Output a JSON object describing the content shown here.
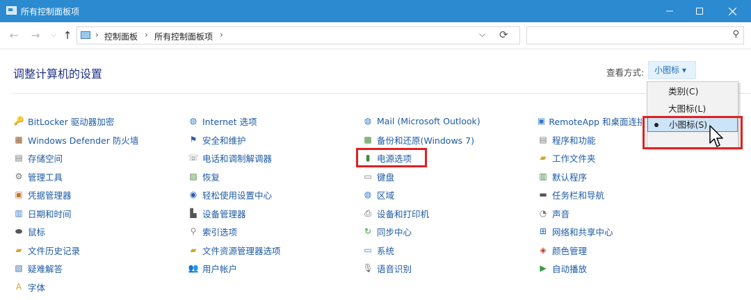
{
  "window": {
    "title": "所有控制面板项"
  },
  "address": {
    "crumbs": [
      "控制面板",
      "所有控制面板项"
    ],
    "dropdown": "⌵",
    "refresh": "⟳",
    "search_placeholder": ""
  },
  "heading": "调整计算机的设置",
  "view": {
    "label": "查看方式:",
    "value": "小图标 ▾",
    "menu": [
      "类别(C)",
      "大图标(L)",
      "小图标(S)"
    ],
    "selected": "小图标(S)"
  },
  "columns": [
    [
      {
        "label": "BitLocker 驱动器加密",
        "icon": "key-icon"
      },
      {
        "label": "Windows Defender 防火墙",
        "icon": "firewall-icon"
      },
      {
        "label": "存储空间",
        "icon": "storage-icon"
      },
      {
        "label": "管理工具",
        "icon": "tools-icon"
      },
      {
        "label": "凭据管理器",
        "icon": "credential-icon"
      },
      {
        "label": "日期和时间",
        "icon": "calendar-icon"
      },
      {
        "label": "鼠标",
        "icon": "mouse-icon"
      },
      {
        "label": "文件历史记录",
        "icon": "file-history-icon"
      },
      {
        "label": "疑难解答",
        "icon": "troubleshoot-icon"
      },
      {
        "label": "字体",
        "icon": "font-icon"
      }
    ],
    [
      {
        "label": "Internet 选项",
        "icon": "globe-icon"
      },
      {
        "label": "安全和维护",
        "icon": "flag-icon"
      },
      {
        "label": "电话和调制解调器",
        "icon": "phone-icon"
      },
      {
        "label": "恢复",
        "icon": "recovery-icon"
      },
      {
        "label": "轻松使用设置中心",
        "icon": "accessibility-icon"
      },
      {
        "label": "设备管理器",
        "icon": "device-manager-icon"
      },
      {
        "label": "索引选项",
        "icon": "index-icon"
      },
      {
        "label": "文件资源管理器选项",
        "icon": "folder-options-icon"
      },
      {
        "label": "用户帐户",
        "icon": "users-icon"
      }
    ],
    [
      {
        "label": "Mail (Microsoft Outlook)",
        "icon": "mail-icon"
      },
      {
        "label": "备份和还原(Windows 7)",
        "icon": "backup-icon"
      },
      {
        "label": "电源选项",
        "icon": "power-icon"
      },
      {
        "label": "键盘",
        "icon": "keyboard-icon"
      },
      {
        "label": "区域",
        "icon": "region-icon"
      },
      {
        "label": "设备和打印机",
        "icon": "printer-icon"
      },
      {
        "label": "同步中心",
        "icon": "sync-icon"
      },
      {
        "label": "系统",
        "icon": "system-icon"
      },
      {
        "label": "语音识别",
        "icon": "microphone-icon"
      }
    ],
    [
      {
        "label": "RemoteApp 和桌面连接",
        "icon": "remoteapp-icon"
      },
      {
        "label": "程序和功能",
        "icon": "programs-icon"
      },
      {
        "label": "工作文件夹",
        "icon": "work-folders-icon"
      },
      {
        "label": "默认程序",
        "icon": "default-programs-icon"
      },
      {
        "label": "任务栏和导航",
        "icon": "taskbar-icon"
      },
      {
        "label": "声音",
        "icon": "speaker-icon"
      },
      {
        "label": "网络和共享中心",
        "icon": "network-icon"
      },
      {
        "label": "颜色管理",
        "icon": "color-icon"
      },
      {
        "label": "自动播放",
        "icon": "autoplay-icon"
      }
    ]
  ],
  "colors": {
    "titlebar": "#2b8ad0",
    "link": "#1c5aa6",
    "heading": "#1e3287",
    "highlight": "#e02020"
  }
}
